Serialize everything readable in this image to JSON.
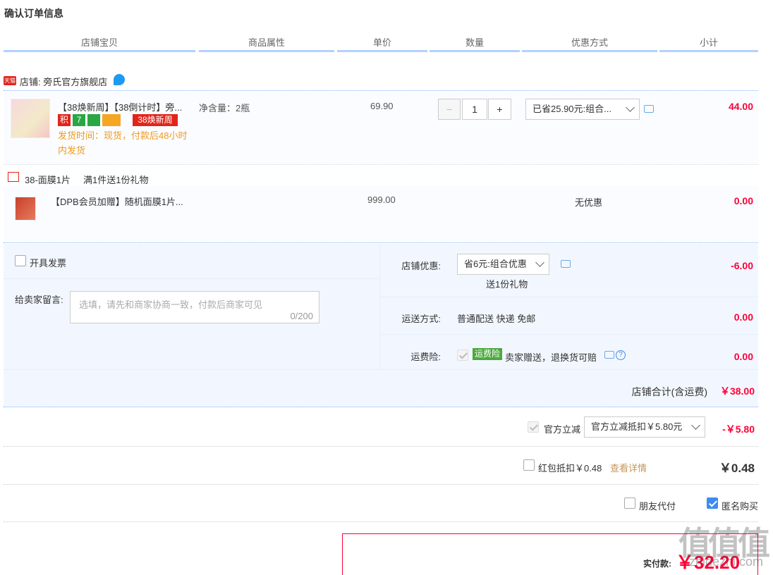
{
  "page": {
    "title": "确认订单信息"
  },
  "columns": [
    "店铺宝贝",
    "商品属性",
    "单价",
    "数量",
    "优惠方式",
    "小计"
  ],
  "shop": {
    "badge": "天猫",
    "name": "店铺: 旁氏官方旗舰店"
  },
  "item": {
    "title": "【38焕新周】【38倒计时】旁...",
    "tags": [
      "积",
      "7",
      "",
      "",
      "38焕新周"
    ],
    "ship_time": "发货时间：现货，付款后48小时内发货",
    "attribute": "净含量：2瓶",
    "unit_price": "69.90",
    "qty_minus": "−",
    "qty": "1",
    "qty_plus": "+",
    "promo": "已省25.90元:组合...",
    "subtotal": "44.00"
  },
  "gift": {
    "header_name": "38-面膜1片",
    "header_rule": "满1件送1份礼物",
    "title": "【DPB会员加赠】随机面膜1片...",
    "unit_price": "999.00",
    "promo": "无优惠",
    "subtotal": "0.00"
  },
  "options": {
    "invoice_label": "开具发票",
    "message_label": "给卖家留言:",
    "message_placeholder": "选填，请先和商家协商一致，付款后商家可见",
    "message_count": "0/200",
    "shop_discount_label": "店铺优惠:",
    "shop_discount_value": "省6元:组合优惠",
    "shop_discount_note": "送1份礼物",
    "shop_discount_amount": "-6.00",
    "shipping_label": "运送方式:",
    "shipping_value": "普通配送 快递 免邮",
    "shipping_amount": "0.00",
    "insurance_label": "运费险:",
    "insurance_badge": "运费险",
    "insurance_text": "卖家赠送，退换货可赔",
    "insurance_help": "?",
    "insurance_amount": "0.00",
    "shop_total_label": "店铺合计(含运费)",
    "shop_total_amount": "￥38.00"
  },
  "official": {
    "label": "官方立减",
    "value": "官方立减抵扣￥5.80元",
    "amount": "-￥5.80"
  },
  "redpacket": {
    "label": "红包抵扣￥0.48",
    "link": "查看详情",
    "amount": "￥0.48"
  },
  "pay_options": {
    "friend_pay": "朋友代付",
    "anonymous": "匿名购买"
  },
  "payment": {
    "label": "实付款:",
    "amount": "￥32.20"
  },
  "watermark": {
    "main": "值值值",
    "sub": "zhidezhi.com"
  },
  "colors": {
    "accent": "#3c8cf0",
    "price_red": "#ff0036",
    "header_line": "#b2d1ff"
  }
}
